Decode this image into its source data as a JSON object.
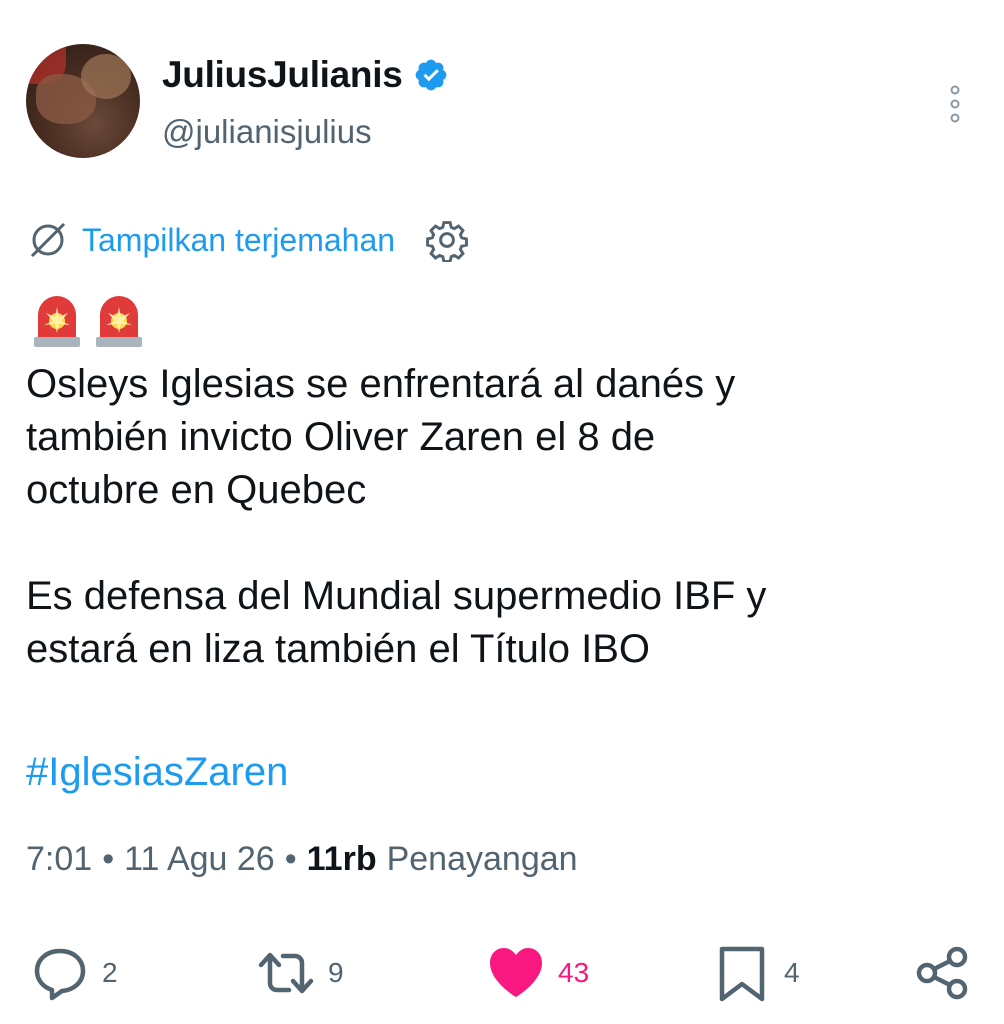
{
  "author": {
    "display_name": "JuliusJulianis",
    "handle": "@julianisjulius",
    "verified": true
  },
  "translate": {
    "label": "Tampilkan terjemahan"
  },
  "post": {
    "emoji": "🚨🚨",
    "text": "Osleys Iglesias se enfrentará al danés y\ntambién invicto Oliver Zaren el 8 de\noctubre en Quebec\n\nEs defensa del Mundial supermedio IBF y\nestará en liza también el Título IBO",
    "hashtag": "#IglesiasZaren"
  },
  "meta": {
    "time": "7:01",
    "date": "11 Agu 26",
    "views_count": "11rb",
    "views_label": "Penayangan",
    "separator": "•"
  },
  "actions": {
    "replies": "2",
    "reposts": "9",
    "likes": "43",
    "bookmarks": "4"
  },
  "colors": {
    "accent": "#1d9bf0",
    "like": "#f91880",
    "muted": "#536471"
  }
}
